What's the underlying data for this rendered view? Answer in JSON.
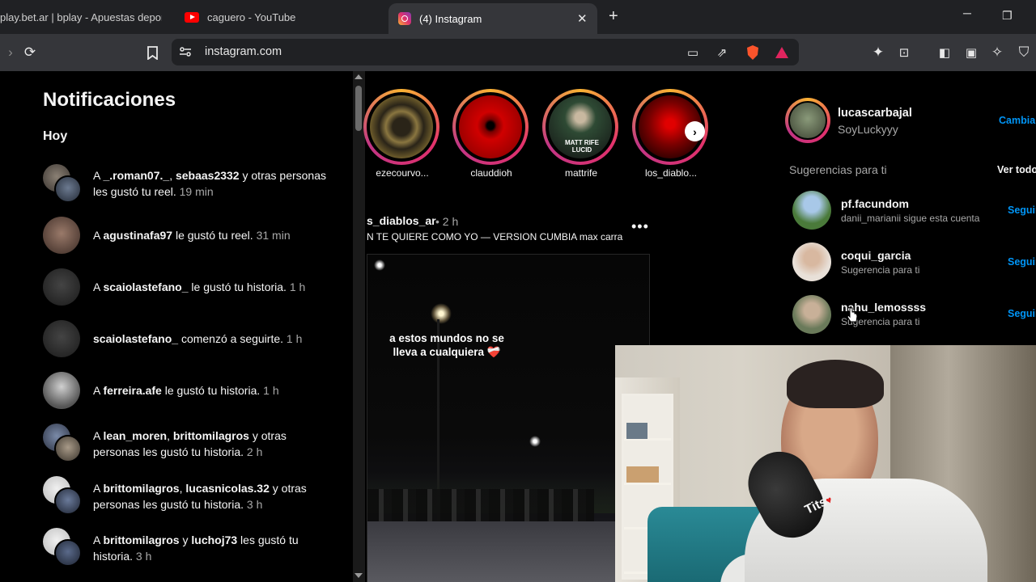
{
  "browser": {
    "tabs": [
      {
        "label": "play.bet.ar | bplay - Apuestas depor",
        "active": false,
        "icon": "none"
      },
      {
        "label": "caguero - YouTube",
        "active": false,
        "icon": "youtube-icon"
      },
      {
        "label": "(4) Instagram",
        "active": true,
        "icon": "instagram-icon"
      }
    ],
    "new_tab": "+",
    "url": "instagram.com",
    "window_controls": {
      "minimize": "─",
      "restore": "❐"
    }
  },
  "notifications": {
    "title": "Notificaciones",
    "section": "Hoy",
    "items": [
      {
        "parts": [
          "A ",
          "_.roman07._",
          ", ",
          "sebaas2332",
          " y otras personas les gustó tu reel."
        ],
        "time": "19 min",
        "avatar": "dual"
      },
      {
        "parts": [
          "A ",
          "agustinafa97",
          " le gustó tu reel.",
          "",
          ""
        ],
        "time": "31 min",
        "avatar": "single"
      },
      {
        "parts": [
          "A ",
          "scaiolastefano_",
          " le gustó tu historia.",
          "",
          ""
        ],
        "time": "1 h",
        "avatar": "single"
      },
      {
        "parts": [
          "",
          "scaiolastefano_",
          " comenzó a seguirte.",
          "",
          ""
        ],
        "time": "1 h",
        "avatar": "single"
      },
      {
        "parts": [
          "A ",
          "ferreira.afe",
          " le gustó tu historia.",
          "",
          ""
        ],
        "time": "1 h",
        "avatar": "single"
      },
      {
        "parts": [
          "A ",
          "lean_moren",
          ", ",
          "brittomilagros",
          " y otras personas les gustó tu historia."
        ],
        "time": "2 h",
        "avatar": "dual"
      },
      {
        "parts": [
          "A ",
          "brittomilagros",
          ", ",
          "lucasnicolas.32",
          " y otras personas les gustó tu historia."
        ],
        "time": "3 h",
        "avatar": "dual"
      },
      {
        "parts": [
          "A ",
          "brittomilagros",
          " y ",
          "luchoj73",
          " les gustó tu historia."
        ],
        "time": "3 h",
        "avatar": "dual"
      }
    ]
  },
  "stories": [
    {
      "name": "ezecourvo...",
      "color": "#6b5a2a"
    },
    {
      "name": "claudd­ioh",
      "color": "#b00000"
    },
    {
      "name": "mattrife",
      "color": "#2a3a2a"
    },
    {
      "name": "los_diablo...",
      "color": "#7a0000"
    }
  ],
  "stories_overlay_text": "MATT RIFE LUCID",
  "post": {
    "user": "s_diablos_ar",
    "time": "• 2 h",
    "audio": "N TE QUIERE COMO YO — VERSION CUMBIA max carra",
    "more": "•••",
    "caption": "a estos mundos no se lleva a cualquiera ❤️‍🩹"
  },
  "sidebar": {
    "me": {
      "username": "lucascarbajal",
      "name": "SoyLuckyyy",
      "switch": "Cambiar"
    },
    "suggestions_title": "Sugerencias para ti",
    "see_all": "Ver todo",
    "suggestions": [
      {
        "username": "pf.facundom",
        "sub": "danii_marianii sigue esta cuenta",
        "action": "Seguir",
        "color": "#4a7a3a"
      },
      {
        "username": "coqui_garcia",
        "sub": "Sugerencia para ti",
        "action": "Seguir",
        "color": "#d8c8b8"
      },
      {
        "username": "nahu_lemossss",
        "sub": "Sugerencia para ti",
        "action": "Seguir",
        "color": "#8a9a7a"
      }
    ]
  },
  "webcam": {
    "shirt_text": "Tits",
    "shirt_heart": "♥"
  }
}
